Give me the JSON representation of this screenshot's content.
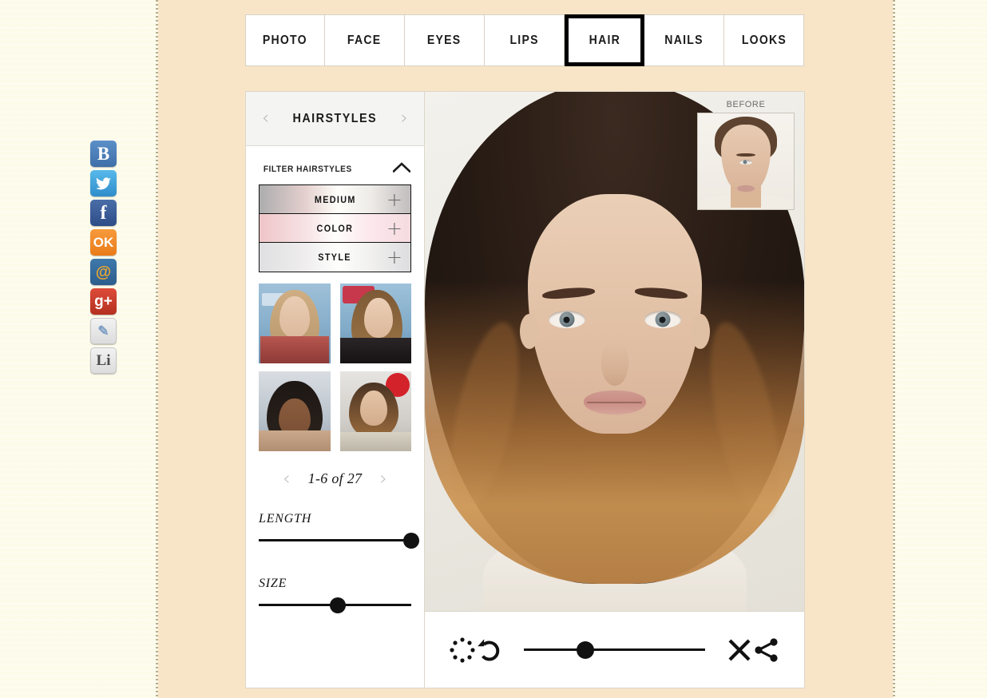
{
  "theme": {
    "page_bg": "#fdfcf0",
    "content_bg": "#f8e5c8",
    "accent": "#000000",
    "panel_bg": "#ffffff",
    "panel_header_bg": "#f4f4f2",
    "border": "#ddd7c9",
    "muted_text": "#b5b5b5"
  },
  "social_rail": {
    "items": [
      {
        "name": "vk",
        "glyph": "B",
        "label": "VK"
      },
      {
        "name": "twitter",
        "glyph": "❖",
        "label": "Twitter"
      },
      {
        "name": "facebook",
        "glyph": "f",
        "label": "Facebook"
      },
      {
        "name": "odnoklassniki",
        "glyph": "OK",
        "label": "Odnoklassniki"
      },
      {
        "name": "mailru",
        "glyph": "@",
        "label": "Mail.ru"
      },
      {
        "name": "googleplus",
        "glyph": "g+",
        "label": "Google Plus"
      },
      {
        "name": "blog",
        "glyph": "✎",
        "label": "Blog"
      },
      {
        "name": "liveinternet",
        "glyph": "Li",
        "label": "LiveInternet"
      }
    ]
  },
  "tabbar": {
    "active": "HAIR",
    "tabs": [
      {
        "label": "PHOTO"
      },
      {
        "label": "FACE"
      },
      {
        "label": "EYES"
      },
      {
        "label": "LIPS"
      },
      {
        "label": "HAIR"
      },
      {
        "label": "NAILS"
      },
      {
        "label": "LOOKS"
      }
    ]
  },
  "panel": {
    "header": {
      "title": "HAIRSTYLES",
      "prev_glyph": "‹",
      "next_glyph": "›"
    },
    "filter": {
      "heading": "FILTER HAIRSTYLES",
      "collapsed": false,
      "collapse_glyph": "^",
      "rows": [
        {
          "label": "MEDIUM",
          "plus": "+"
        },
        {
          "label": "COLOR",
          "plus": "+"
        },
        {
          "label": "STYLE",
          "plus": "+"
        }
      ]
    },
    "thumbnails": [
      {
        "name": "hairstyle-thumb-1",
        "alt": "Long wavy blonde hairstyle"
      },
      {
        "name": "hairstyle-thumb-2",
        "alt": "Side-swept wavy bronde hairstyle"
      },
      {
        "name": "hairstyle-thumb-3",
        "alt": "Straight dark hair with blunt bangs"
      },
      {
        "name": "hairstyle-thumb-4",
        "alt": "Ombre wavy bob hairstyle"
      }
    ],
    "pager": {
      "label": "1-6 of 27",
      "prev_glyph": "‹",
      "next_glyph": "›",
      "range_start": 1,
      "range_end": 6,
      "total": 27
    },
    "sliders": [
      {
        "name": "length",
        "label": "LENGTH",
        "value": 100
      },
      {
        "name": "size",
        "label": "SIZE",
        "value": 52
      }
    ]
  },
  "stage": {
    "before": {
      "label": "BEFORE",
      "alt": "Original photo of model before hairstyle applied"
    },
    "photo": {
      "alt": "Model with dark brown ombre wavy mid-length hairstyle applied"
    }
  },
  "toolbar": {
    "buttons": [
      {
        "name": "loading-dots",
        "label": "Processing"
      },
      {
        "name": "undo",
        "label": "Undo"
      },
      {
        "name": "close",
        "label": "Close"
      },
      {
        "name": "share",
        "label": "Share"
      }
    ],
    "opacity_slider": {
      "name": "opacity",
      "label": "Opacity",
      "value": 34
    }
  }
}
